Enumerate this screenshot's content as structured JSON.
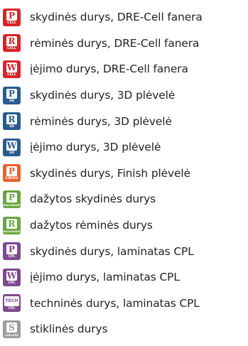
{
  "legend": {
    "items": [
      {
        "icon": "cell-panel-door-icon",
        "letter": "P",
        "sub": "CELL",
        "color": "#d7242a",
        "label": "skydinės durys, DRE-Cell fanera"
      },
      {
        "icon": "cell-frame-door-icon",
        "letter": "R",
        "sub": "CELL",
        "color": "#d7242a",
        "label": "rėminės durys, DRE-Cell fanera"
      },
      {
        "icon": "cell-entrance-door-icon",
        "letter": "W",
        "sub": "CELL",
        "color": "#d7242a",
        "label": "įėjimo durys, DRE-Cell fanera"
      },
      {
        "icon": "3d-panel-door-icon",
        "letter": "P",
        "sub": "3D",
        "color": "#2a5b8f",
        "label": "skydinės durys, 3D plėvelė"
      },
      {
        "icon": "3d-frame-door-icon",
        "letter": "R",
        "sub": "3D",
        "color": "#2a5b8f",
        "label": "rėminės durys, 3D plėvelė"
      },
      {
        "icon": "3d-entrance-door-icon",
        "letter": "W",
        "sub": "3D",
        "color": "#2a5b8f",
        "label": "įėjimo durys, 3D plėvelė"
      },
      {
        "icon": "finish-panel-door-icon",
        "letter": "P",
        "sub": "FINISH",
        "color": "#e8622a",
        "label": "skydinės durys, Finish plėvelė"
      },
      {
        "icon": "painted-panel-door-icon",
        "letter": "P",
        "sub": "MALOWANE",
        "color": "#6aa63c",
        "label": "dažytos skydinės durys"
      },
      {
        "icon": "painted-frame-door-icon",
        "letter": "R",
        "sub": "MALOWANE",
        "color": "#6aa63c",
        "label": "dažytos rėminės durys"
      },
      {
        "icon": "cpl-panel-door-icon",
        "letter": "P",
        "sub": "CPL",
        "color": "#7d4a8f",
        "label": "skydinės durys, laminatas CPL"
      },
      {
        "icon": "cpl-entrance-door-icon",
        "letter": "W",
        "sub": "CPL",
        "color": "#7d4a8f",
        "label": "įėjimo durys, laminatas CPL"
      },
      {
        "icon": "cpl-technical-door-icon",
        "letter": "TECH",
        "sub": "CPL",
        "color": "#7d4a8f",
        "label": "techninės durys, laminatas CPL"
      },
      {
        "icon": "glass-door-icon",
        "letter": "S",
        "sub": "SZKLANE",
        "color": "#9c9c9c",
        "label": "stiklinės durys"
      }
    ]
  }
}
